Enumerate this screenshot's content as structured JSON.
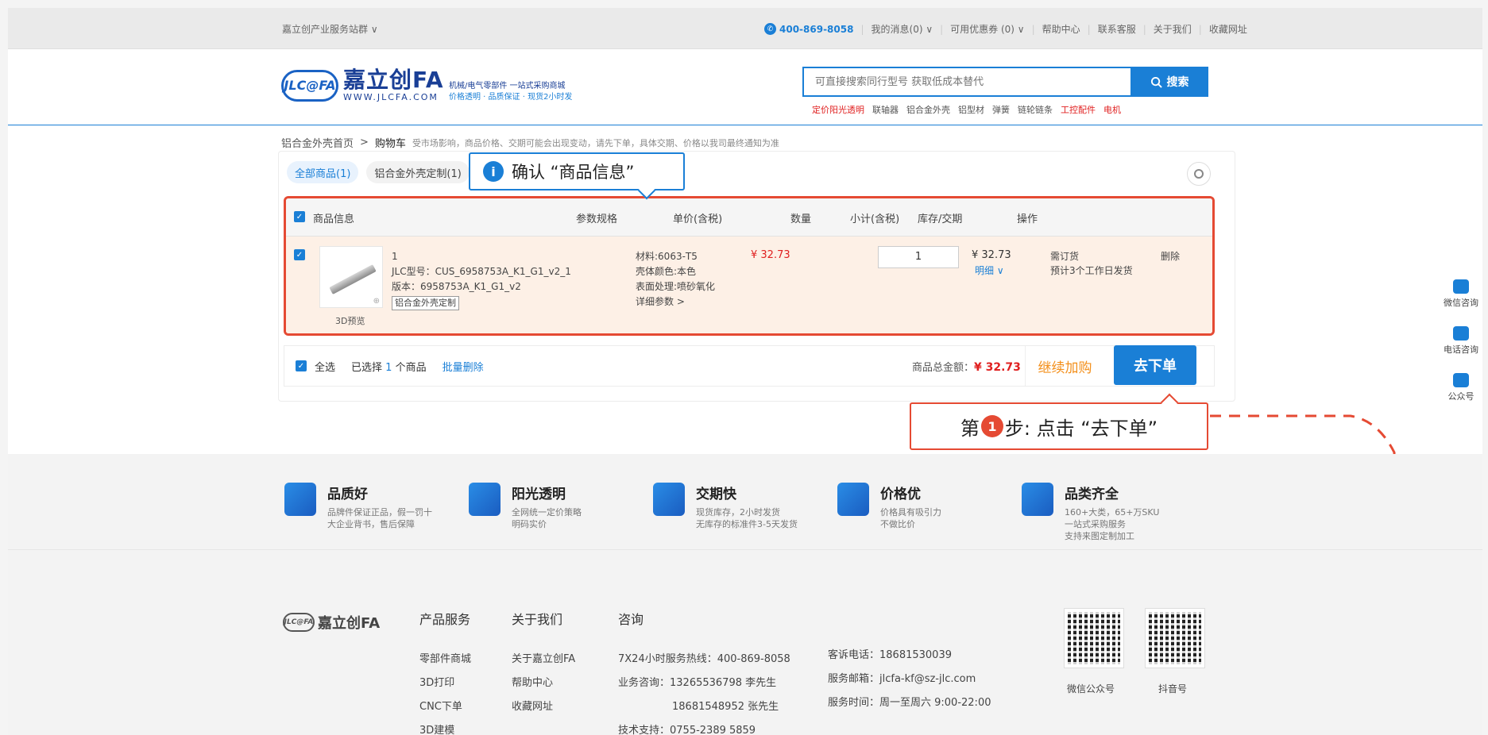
{
  "topbar": {
    "group": "嘉立创产业服务站群 ∨",
    "phone": "400-869-8058",
    "messages": "我的消息(0) ∨",
    "coupons": "可用优惠券 (0) ∨",
    "help": "帮助中心",
    "contact": "联系客服",
    "about": "关于我们",
    "bookmark": "收藏网址"
  },
  "header": {
    "logo_badge": "JLC@FA",
    "brand": "嘉立创FA",
    "url": "WWW.JLCFA.COM",
    "slogan1": "机械/电气零部件  一站式采购商城",
    "slogan2": "价格透明 · 品质保证 · 现货2小时发",
    "search_placeholder": "可直接搜索同行型号 获取低成本替代",
    "search_button": "搜索",
    "hotlinks": [
      {
        "text": "定价阳光透明",
        "red": true
      },
      {
        "text": "联轴器",
        "red": false
      },
      {
        "text": "铝合金外壳",
        "red": false
      },
      {
        "text": "铝型材",
        "red": false
      },
      {
        "text": "弹簧",
        "red": false
      },
      {
        "text": "链轮链条",
        "red": false
      },
      {
        "text": "工控配件",
        "red": true
      },
      {
        "text": "电机",
        "red": true
      }
    ]
  },
  "breadcrumb": {
    "home": "铝合金外壳首页",
    "sep": ">",
    "current": "购物车",
    "note": "受市场影响，商品价格、交期可能会出现变动，请先下单，具体交期、价格以我司最终通知为准"
  },
  "tabs": [
    {
      "label": "全部商品(1)",
      "active": true
    },
    {
      "label": "铝合金外壳定制(1)",
      "active": false
    }
  ],
  "table": {
    "headers": {
      "info": "商品信息",
      "spec": "参数规格",
      "price": "单价(含税)",
      "qty": "数量",
      "subtotal": "小计(含税)",
      "stock": "库存/交期",
      "op": "操作"
    },
    "row": {
      "name": "1",
      "model": "JLC型号：CUS_6958753A_K1_G1_v2_1",
      "version": "版本：6958753A_K1_G1_v2",
      "tag": "铝合金外壳定制",
      "preview": "3D预览",
      "spec1": "材料:6063-T5",
      "spec2": "壳体颜色:本色",
      "spec3": "表面处理:喷砂氧化",
      "spec4": "详细参数 >",
      "price": "¥ 32.73",
      "qty": "1",
      "subtotal": "¥ 32.73",
      "detail": "明细 ∨",
      "stock1": "需订货",
      "stock2": "预计3个工作日发货",
      "delete": "删除"
    }
  },
  "summary": {
    "select_all": "全选",
    "selected_prefix": "已选择",
    "selected_count": "1",
    "selected_suffix": "个商品",
    "batch_delete": "批量删除",
    "total_label": "商品总金额：",
    "total_value": "¥ 32.73",
    "continue": "继续加购",
    "order": "去下单"
  },
  "annotations": {
    "confirm": "确认 “商品信息”",
    "step_prefix": "第",
    "step_num": "1",
    "step_suffix": "步: 点击 “去下单”"
  },
  "rightfloat": [
    "微信咨询",
    "电话咨询",
    "公众号"
  ],
  "features": [
    {
      "title": "品质好",
      "line1": "品牌件保证正品，假一罚十",
      "line2": "大企业背书，售后保障",
      "line3": ""
    },
    {
      "title": "阳光透明",
      "line1": "全网统一定价策略",
      "line2": "明码实价",
      "line3": ""
    },
    {
      "title": "交期快",
      "line1": "现货库存，2小时发货",
      "line2": "无库存的标准件3-5天发货",
      "line3": ""
    },
    {
      "title": "价格优",
      "line1": "价格具有吸引力",
      "line2": "不做比价",
      "line3": ""
    },
    {
      "title": "品类齐全",
      "line1": "160+大类，65+万SKU",
      "line2": "一站式采购服务",
      "line3": "支持来图定制加工"
    }
  ],
  "footer": {
    "logo_badge": "JLC@FA",
    "logo_text": "嘉立创FA",
    "col1_title": "产品服务",
    "col1": [
      "零部件商城",
      "3D打印",
      "CNC下单",
      "3D建模"
    ],
    "col2_title": "关于我们",
    "col2": [
      "关于嘉立创FA",
      "帮助中心",
      "收藏网址"
    ],
    "col3_title": "咨询",
    "col3": [
      "7X24小时服务热线：400-869-8058",
      "业务咨询：13265536798 李先生",
      "18681548952 张先生",
      "技术支持：0755-2389 5859"
    ],
    "col4": [
      "客诉电话：18681530039",
      "服务邮箱：jlcfa-kf@sz-jlc.com",
      "服务时间：周一至周六 9:00-22:00"
    ],
    "qr1": "微信公众号",
    "qr2": "抖音号"
  }
}
